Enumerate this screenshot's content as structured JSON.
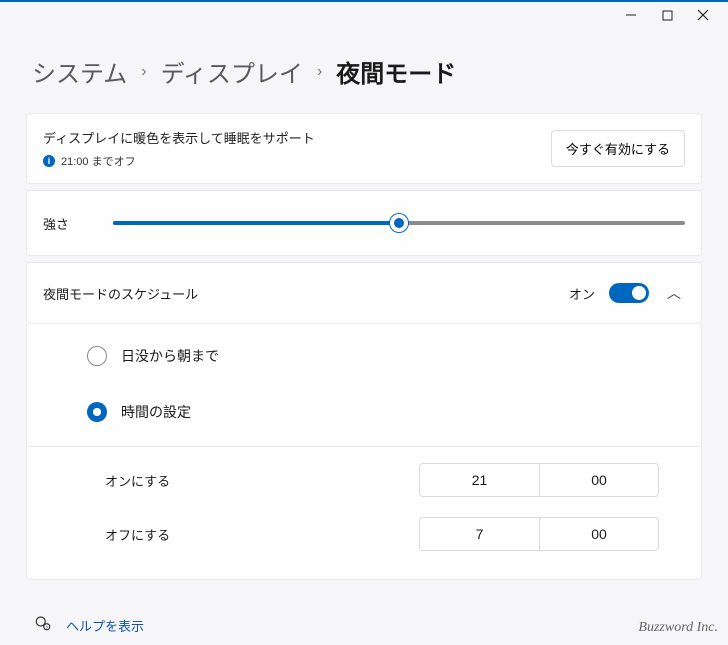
{
  "breadcrumb": {
    "level1": "システム",
    "level2": "ディスプレイ",
    "current": "夜間モード"
  },
  "intro": {
    "description": "ディスプレイに暖色を表示して睡眠をサポート",
    "status": "21:00 までオフ",
    "turn_on_now": "今すぐ有効にする"
  },
  "strength": {
    "label": "強さ",
    "value": 50,
    "max": 100
  },
  "schedule": {
    "title": "夜間モードのスケジュール",
    "state_label": "オン",
    "enabled": true,
    "expanded": true,
    "options": {
      "sunset": "日没から朝まで",
      "set_hours": "時間の設定",
      "selected": "set_hours"
    },
    "turn_on": {
      "label": "オンにする",
      "hour": "21",
      "minute": "00"
    },
    "turn_off": {
      "label": "オフにする",
      "hour": "7",
      "minute": "00"
    }
  },
  "help": {
    "label": "ヘルプを表示"
  },
  "footer": {
    "brand": "Buzzword Inc."
  }
}
